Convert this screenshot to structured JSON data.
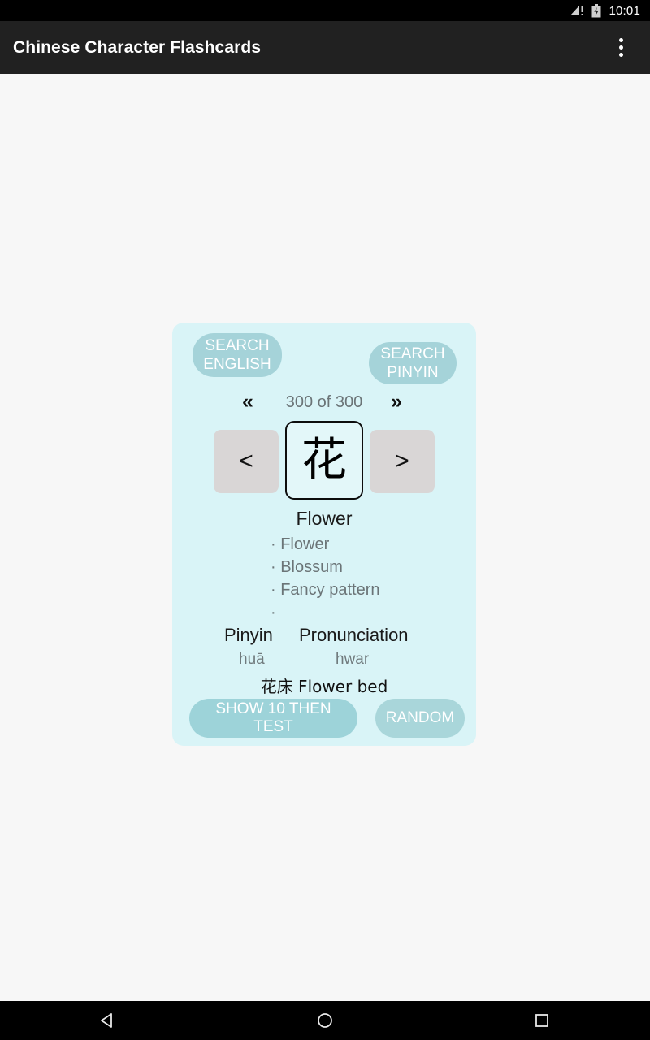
{
  "status_bar": {
    "time": "10:01",
    "signal_icon": "signal-no-sim-icon",
    "battery_icon": "battery-charging-icon"
  },
  "app_bar": {
    "title": "Chinese Character Flashcards",
    "overflow_icon": "overflow-menu-icon"
  },
  "card": {
    "search_english_label": "SEARCH\nENGLISH",
    "search_pinyin_label": "SEARCH\nPINYIN",
    "first_chevron": "«",
    "last_chevron": "»",
    "counter": "300 of 300",
    "prev_label": "<",
    "next_label": ">",
    "character": "花",
    "primary_meaning": "Flower",
    "meanings": [
      "· Flower",
      "· Blossum",
      "· Fancy pattern",
      "· "
    ],
    "pinyin_header": "Pinyin",
    "pronunciation_header": "Pronunciation",
    "pinyin_value": "huā",
    "pronunciation_value": "hwar",
    "example": "花床 Flower bed",
    "show_test_label": "SHOW 10 THEN TEST",
    "random_label": "RANDOM"
  },
  "nav_bar": {
    "back_icon": "back-triangle-icon",
    "home_icon": "home-circle-icon",
    "recents_icon": "recents-square-icon"
  },
  "colors": {
    "page_background": "#f7f7f7",
    "app_bar": "#212121",
    "card_background": "#d9f4f7",
    "accent_button": "#a5d3d9",
    "nav_square_button": "#d9d6d6",
    "muted_text": "#6b7477"
  }
}
